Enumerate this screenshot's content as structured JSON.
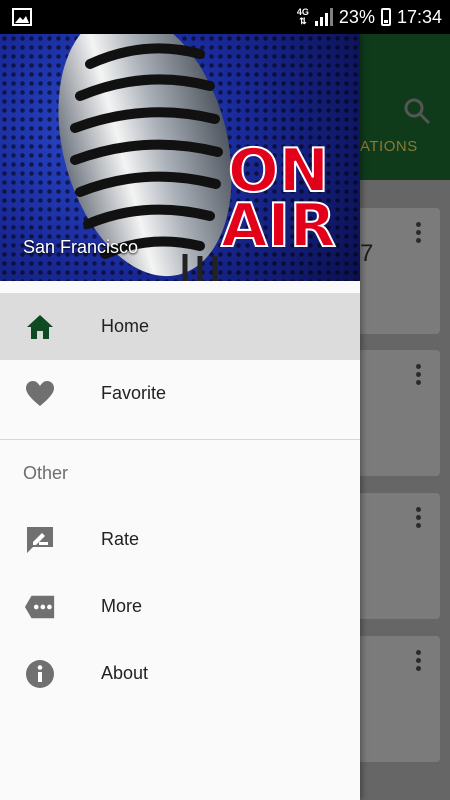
{
  "status_bar": {
    "network": "4G",
    "battery": "23%",
    "time": "17:34"
  },
  "app": {
    "tab_partial": "ATIONS",
    "card_partial_text": "7"
  },
  "drawer": {
    "header_city": "San Francisco",
    "header_badge_line1": "ON",
    "header_badge_line2": "AIR",
    "items": [
      {
        "label": "Home",
        "icon": "home-icon",
        "active": true
      },
      {
        "label": "Favorite",
        "icon": "heart-icon",
        "active": false
      }
    ],
    "section_label": "Other",
    "other_items": [
      {
        "label": "Rate",
        "icon": "rate-icon"
      },
      {
        "label": "More",
        "icon": "more-icon"
      },
      {
        "label": "About",
        "icon": "info-icon"
      }
    ]
  },
  "colors": {
    "primary_dark": "#0f3b1b",
    "home_icon": "#0f4a22",
    "inactive_icon": "#707070",
    "onair_red": "#e3001b"
  }
}
